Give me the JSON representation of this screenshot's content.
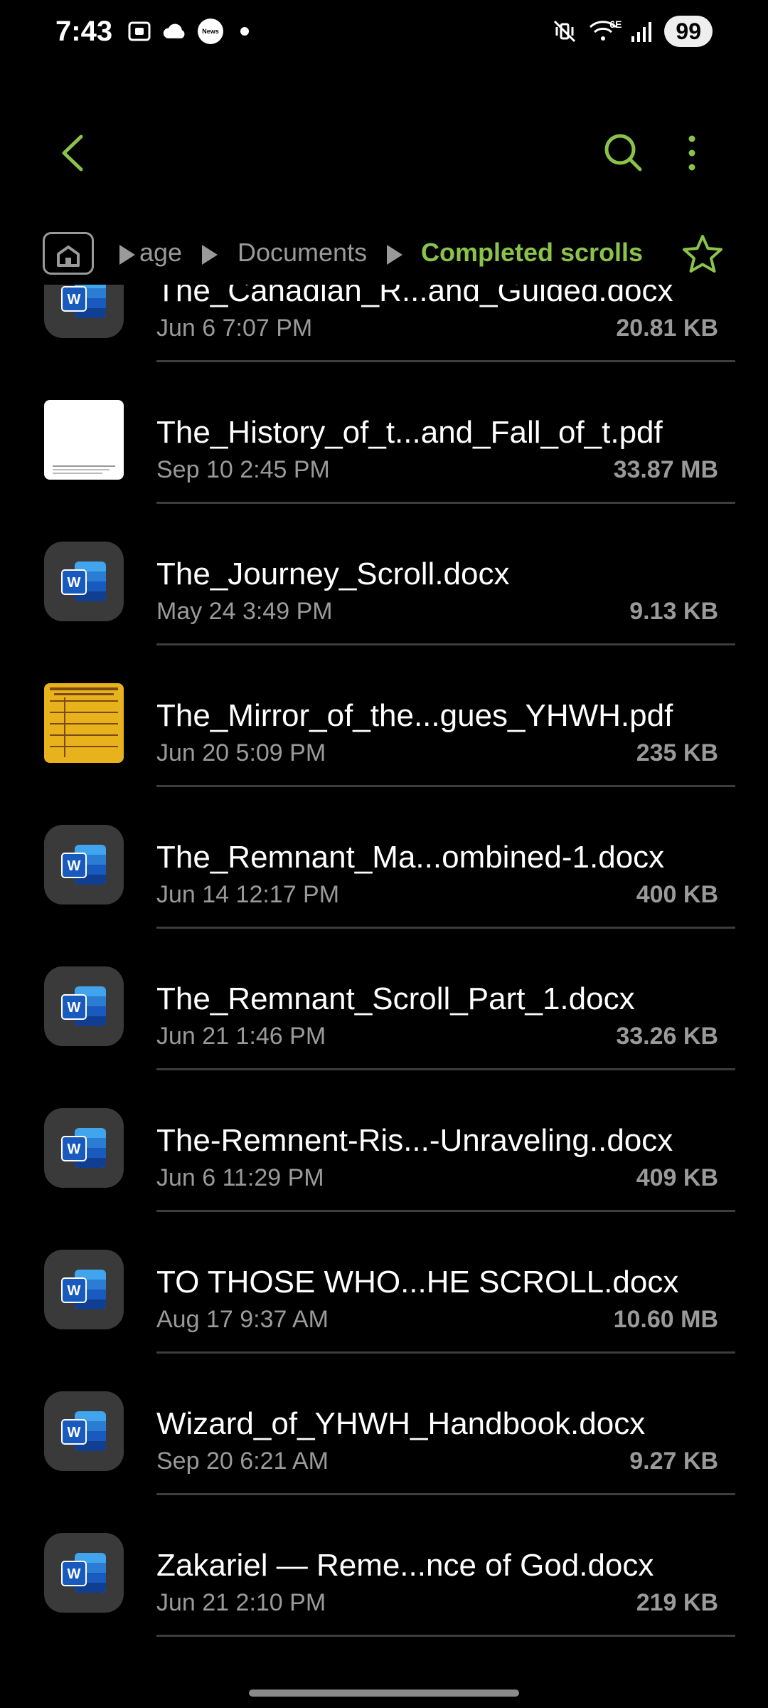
{
  "status_bar": {
    "time": "7:43",
    "left_icons": [
      "screenshot-icon",
      "cloud-icon",
      "news-icon",
      "dot-icon"
    ],
    "news_label": "News",
    "network_label": "6E",
    "battery": "99"
  },
  "toolbar": {
    "back_icon": "back-arrow-icon",
    "search_icon": "search-icon",
    "more_icon": "more-vert-icon",
    "accent_color": "#8bc34a"
  },
  "breadcrumb": {
    "home_icon": "home-icon",
    "items": [
      "age",
      "Documents",
      "Completed scrolls"
    ],
    "favorite_icon": "star-icon"
  },
  "files": [
    {
      "name": "The_Canadian_R...and_Guided.docx",
      "date": "Jun 6 7:07 PM",
      "size": "20.81 KB",
      "type": "word"
    },
    {
      "name": "The_History_of_t...and_Fall_of_t.pdf",
      "date": "Sep 10 2:45 PM",
      "size": "33.87 MB",
      "type": "pdf-white"
    },
    {
      "name": "The_Journey_Scroll.docx",
      "date": "May 24 3:49 PM",
      "size": "9.13 KB",
      "type": "word"
    },
    {
      "name": "The_Mirror_of_the...gues_YHWH.pdf",
      "date": "Jun 20 5:09 PM",
      "size": "235 KB",
      "type": "pdf-yellow"
    },
    {
      "name": "The_Remnant_Ma...ombined-1.docx",
      "date": "Jun 14 12:17 PM",
      "size": "400 KB",
      "type": "word"
    },
    {
      "name": "The_Remnant_Scroll_Part_1.docx",
      "date": "Jun 21 1:46 PM",
      "size": "33.26 KB",
      "type": "word"
    },
    {
      "name": "The-Remnent-Ris...-Unraveling..docx",
      "date": "Jun 6 11:29 PM",
      "size": "409 KB",
      "type": "word"
    },
    {
      "name": "TO THOSE WHO...HE SCROLL.docx",
      "date": "Aug 17 9:37 AM",
      "size": "10.60 MB",
      "type": "word"
    },
    {
      "name": "Wizard_of_YHWH_Handbook.docx",
      "date": "Sep 20 6:21 AM",
      "size": "9.27 KB",
      "type": "word"
    },
    {
      "name": "Zakariel — Reme...nce of God.docx",
      "date": "Jun 21 2:10 PM",
      "size": "219 KB",
      "type": "word"
    }
  ]
}
